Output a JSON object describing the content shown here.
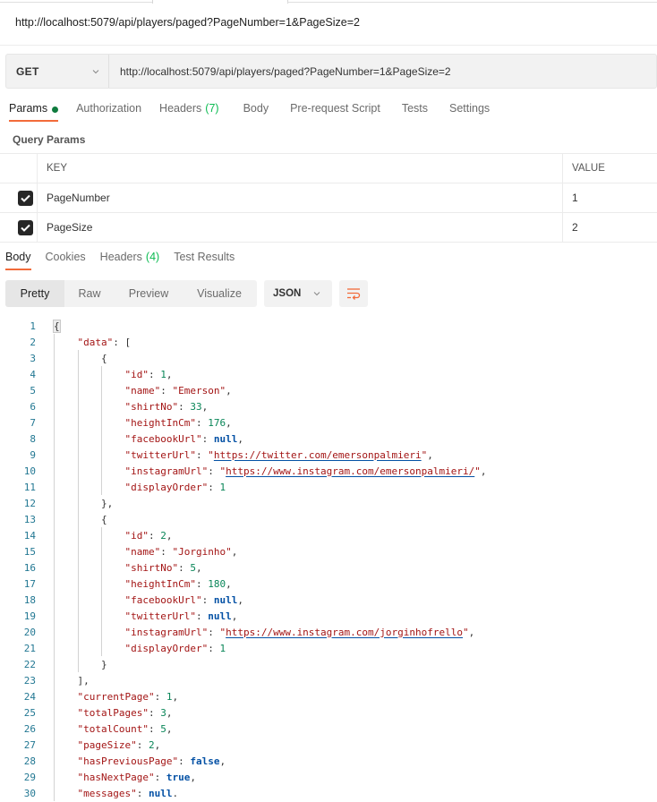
{
  "request": {
    "title": "http://localhost:5079/api/players/paged?PageNumber=1&PageSize=2",
    "method": "GET",
    "url": "http://localhost:5079/api/players/paged?PageNumber=1&PageSize=2"
  },
  "request_tabs": [
    {
      "label": "Params",
      "active": true,
      "indicator": "green-dot"
    },
    {
      "label": "Authorization"
    },
    {
      "label": "Headers",
      "count": "(7)"
    },
    {
      "label": "Body"
    },
    {
      "label": "Pre-request Script"
    },
    {
      "label": "Tests"
    },
    {
      "label": "Settings"
    }
  ],
  "query_params": {
    "title": "Query Params",
    "columns": {
      "key": "KEY",
      "value": "VALUE"
    },
    "rows": [
      {
        "checked": true,
        "key": "PageNumber",
        "value": "1"
      },
      {
        "checked": true,
        "key": "PageSize",
        "value": "2"
      }
    ]
  },
  "response_tabs": [
    {
      "label": "Body",
      "active": true
    },
    {
      "label": "Cookies"
    },
    {
      "label": "Headers",
      "count": "(4)"
    },
    {
      "label": "Test Results"
    }
  ],
  "view_modes": [
    "Pretty",
    "Raw",
    "Preview",
    "Visualize"
  ],
  "active_view": "Pretty",
  "format": "JSON",
  "colors": {
    "accent": "#f26b3a",
    "count_green": "#0cbb52",
    "params_dot": "#0f7b3e",
    "json_key": "#a31515",
    "json_number": "#098658",
    "json_keyword": "#0451a5",
    "line_number": "#237893"
  },
  "response_lines": [
    {
      "n": 1,
      "indent": 0,
      "tokens": [
        [
          "bm",
          "{"
        ]
      ]
    },
    {
      "n": 2,
      "indent": 1,
      "tokens": [
        [
          "k",
          "\"data\""
        ],
        [
          "p",
          ": ["
        ]
      ]
    },
    {
      "n": 3,
      "indent": 2,
      "tokens": [
        [
          "p",
          "{"
        ]
      ]
    },
    {
      "n": 4,
      "indent": 3,
      "tokens": [
        [
          "k",
          "\"id\""
        ],
        [
          "p",
          ": "
        ],
        [
          "n",
          "1"
        ],
        [
          "p",
          ","
        ]
      ]
    },
    {
      "n": 5,
      "indent": 3,
      "tokens": [
        [
          "k",
          "\"name\""
        ],
        [
          "p",
          ": "
        ],
        [
          "s",
          "\"Emerson\""
        ],
        [
          "p",
          ","
        ]
      ]
    },
    {
      "n": 6,
      "indent": 3,
      "tokens": [
        [
          "k",
          "\"shirtNo\""
        ],
        [
          "p",
          ": "
        ],
        [
          "n",
          "33"
        ],
        [
          "p",
          ","
        ]
      ]
    },
    {
      "n": 7,
      "indent": 3,
      "tokens": [
        [
          "k",
          "\"heightInCm\""
        ],
        [
          "p",
          ": "
        ],
        [
          "n",
          "176"
        ],
        [
          "p",
          ","
        ]
      ]
    },
    {
      "n": 8,
      "indent": 3,
      "tokens": [
        [
          "k",
          "\"facebookUrl\""
        ],
        [
          "p",
          ": "
        ],
        [
          "kw",
          "null"
        ],
        [
          "p",
          ","
        ]
      ]
    },
    {
      "n": 9,
      "indent": 3,
      "tokens": [
        [
          "k",
          "\"twitterUrl\""
        ],
        [
          "p",
          ": "
        ],
        [
          "s",
          "\""
        ],
        [
          "sl",
          "https://twitter.com/emersonpalmieri"
        ],
        [
          "s",
          "\""
        ],
        [
          "p",
          ","
        ]
      ]
    },
    {
      "n": 10,
      "indent": 3,
      "tokens": [
        [
          "k",
          "\"instagramUrl\""
        ],
        [
          "p",
          ": "
        ],
        [
          "s",
          "\""
        ],
        [
          "sl",
          "https://www.instagram.com/emersonpalmieri/"
        ],
        [
          "s",
          "\""
        ],
        [
          "p",
          ","
        ]
      ]
    },
    {
      "n": 11,
      "indent": 3,
      "tokens": [
        [
          "k",
          "\"displayOrder\""
        ],
        [
          "p",
          ": "
        ],
        [
          "n",
          "1"
        ]
      ]
    },
    {
      "n": 12,
      "indent": 2,
      "tokens": [
        [
          "p",
          "},"
        ]
      ]
    },
    {
      "n": 13,
      "indent": 2,
      "tokens": [
        [
          "p",
          "{"
        ]
      ]
    },
    {
      "n": 14,
      "indent": 3,
      "tokens": [
        [
          "k",
          "\"id\""
        ],
        [
          "p",
          ": "
        ],
        [
          "n",
          "2"
        ],
        [
          "p",
          ","
        ]
      ]
    },
    {
      "n": 15,
      "indent": 3,
      "tokens": [
        [
          "k",
          "\"name\""
        ],
        [
          "p",
          ": "
        ],
        [
          "s",
          "\"Jorginho\""
        ],
        [
          "p",
          ","
        ]
      ]
    },
    {
      "n": 16,
      "indent": 3,
      "tokens": [
        [
          "k",
          "\"shirtNo\""
        ],
        [
          "p",
          ": "
        ],
        [
          "n",
          "5"
        ],
        [
          "p",
          ","
        ]
      ]
    },
    {
      "n": 17,
      "indent": 3,
      "tokens": [
        [
          "k",
          "\"heightInCm\""
        ],
        [
          "p",
          ": "
        ],
        [
          "n",
          "180"
        ],
        [
          "p",
          ","
        ]
      ]
    },
    {
      "n": 18,
      "indent": 3,
      "tokens": [
        [
          "k",
          "\"facebookUrl\""
        ],
        [
          "p",
          ": "
        ],
        [
          "kw",
          "null"
        ],
        [
          "p",
          ","
        ]
      ]
    },
    {
      "n": 19,
      "indent": 3,
      "tokens": [
        [
          "k",
          "\"twitterUrl\""
        ],
        [
          "p",
          ": "
        ],
        [
          "kw",
          "null"
        ],
        [
          "p",
          ","
        ]
      ]
    },
    {
      "n": 20,
      "indent": 3,
      "tokens": [
        [
          "k",
          "\"instagramUrl\""
        ],
        [
          "p",
          ": "
        ],
        [
          "s",
          "\""
        ],
        [
          "sl",
          "https://www.instagram.com/jorginhofrello"
        ],
        [
          "s",
          "\""
        ],
        [
          "p",
          ","
        ]
      ]
    },
    {
      "n": 21,
      "indent": 3,
      "tokens": [
        [
          "k",
          "\"displayOrder\""
        ],
        [
          "p",
          ": "
        ],
        [
          "n",
          "1"
        ]
      ]
    },
    {
      "n": 22,
      "indent": 2,
      "tokens": [
        [
          "p",
          "}"
        ]
      ]
    },
    {
      "n": 23,
      "indent": 1,
      "tokens": [
        [
          "p",
          "],"
        ]
      ]
    },
    {
      "n": 24,
      "indent": 1,
      "tokens": [
        [
          "k",
          "\"currentPage\""
        ],
        [
          "p",
          ": "
        ],
        [
          "n",
          "1"
        ],
        [
          "p",
          ","
        ]
      ]
    },
    {
      "n": 25,
      "indent": 1,
      "tokens": [
        [
          "k",
          "\"totalPages\""
        ],
        [
          "p",
          ": "
        ],
        [
          "n",
          "3"
        ],
        [
          "p",
          ","
        ]
      ]
    },
    {
      "n": 26,
      "indent": 1,
      "tokens": [
        [
          "k",
          "\"totalCount\""
        ],
        [
          "p",
          ": "
        ],
        [
          "n",
          "5"
        ],
        [
          "p",
          ","
        ]
      ]
    },
    {
      "n": 27,
      "indent": 1,
      "tokens": [
        [
          "k",
          "\"pageSize\""
        ],
        [
          "p",
          ": "
        ],
        [
          "n",
          "2"
        ],
        [
          "p",
          ","
        ]
      ]
    },
    {
      "n": 28,
      "indent": 1,
      "tokens": [
        [
          "k",
          "\"hasPreviousPage\""
        ],
        [
          "p",
          ": "
        ],
        [
          "kw",
          "false"
        ],
        [
          "p",
          ","
        ]
      ]
    },
    {
      "n": 29,
      "indent": 1,
      "tokens": [
        [
          "k",
          "\"hasNextPage\""
        ],
        [
          "p",
          ": "
        ],
        [
          "kw",
          "true"
        ],
        [
          "p",
          ","
        ]
      ]
    },
    {
      "n": 30,
      "indent": 1,
      "tokens": [
        [
          "k",
          "\"messages\""
        ],
        [
          "p",
          ": "
        ],
        [
          "kw",
          "null"
        ],
        [
          "p",
          "."
        ]
      ]
    }
  ]
}
